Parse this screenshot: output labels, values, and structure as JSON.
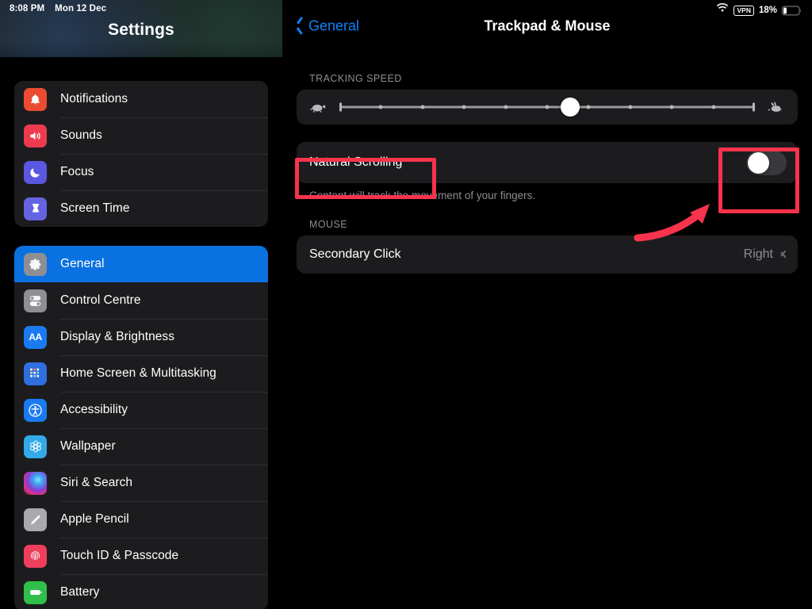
{
  "status_bar": {
    "time": "8:08 PM",
    "date": "Mon 12 Dec",
    "wifi_icon": "wifi-icon",
    "vpn_label": "VPN",
    "battery_percent": "18%",
    "battery_icon": "battery-icon"
  },
  "sidebar": {
    "title": "Settings",
    "groups": [
      {
        "items": [
          {
            "label": "Notifications",
            "icon": "bell-icon",
            "selected": false
          },
          {
            "label": "Sounds",
            "icon": "speaker-icon",
            "selected": false
          },
          {
            "label": "Focus",
            "icon": "moon-icon",
            "selected": false
          },
          {
            "label": "Screen Time",
            "icon": "hourglass-icon",
            "selected": false
          }
        ]
      },
      {
        "items": [
          {
            "label": "General",
            "icon": "gear-icon",
            "selected": true
          },
          {
            "label": "Control Centre",
            "icon": "toggles-icon",
            "selected": false
          },
          {
            "label": "Display & Brightness",
            "icon": "aa-text-icon",
            "selected": false
          },
          {
            "label": "Home Screen & Multitasking",
            "icon": "app-grid-icon",
            "selected": false
          },
          {
            "label": "Accessibility",
            "icon": "accessibility-person-icon",
            "selected": false
          },
          {
            "label": "Wallpaper",
            "icon": "flower-icon",
            "selected": false
          },
          {
            "label": "Siri & Search",
            "icon": "siri-orb-icon",
            "selected": false
          },
          {
            "label": "Apple Pencil",
            "icon": "pencil-icon",
            "selected": false
          },
          {
            "label": "Touch ID & Passcode",
            "icon": "fingerprint-icon",
            "selected": false
          },
          {
            "label": "Battery",
            "icon": "battery-icon",
            "selected": false
          }
        ]
      }
    ]
  },
  "detail": {
    "back_label": "General",
    "back_icon": "chevron-left-icon",
    "title": "Trackpad & Mouse",
    "tracking_speed": {
      "header": "TRACKING SPEED",
      "slow_icon": "tortoise-icon",
      "fast_icon": "hare-icon",
      "tick_count": 9,
      "value_percent": 55.5
    },
    "natural_scrolling": {
      "label": "Natural Scrolling",
      "toggle_state": "off",
      "footnote": "Content will track the movement of your fingers."
    },
    "mouse": {
      "header": "MOUSE",
      "secondary_click": {
        "label": "Secondary Click",
        "value": "Right",
        "chevron_icon": "chevron-right-icon"
      }
    }
  },
  "annotations": {
    "highlight_color": "#f8334c",
    "label_box": "natural-scrolling-label-highlight",
    "toggle_box": "natural-scrolling-toggle-highlight",
    "arrow": "pointer-arrow-to-toggle"
  }
}
